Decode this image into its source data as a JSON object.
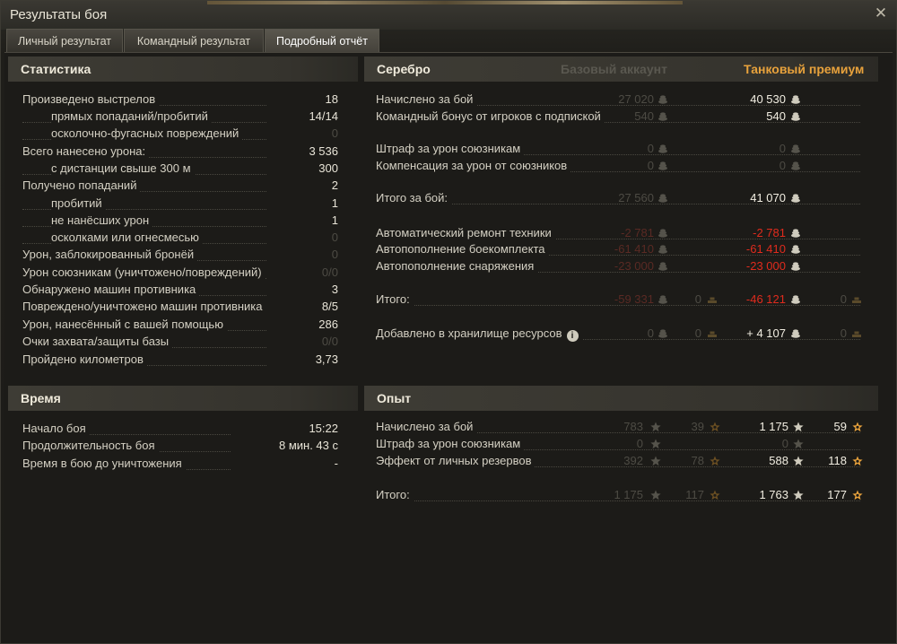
{
  "window": {
    "title": "Результаты боя",
    "close_symbol": "✕"
  },
  "tabs": [
    {
      "label": "Личный результат",
      "active": false
    },
    {
      "label": "Командный результат",
      "active": false
    },
    {
      "label": "Подробный отчёт",
      "active": true
    }
  ],
  "colors": {
    "gold_premium": "#e8a23c",
    "red": "#e02b1d",
    "dim": "#4d4b44"
  },
  "stats": {
    "header": "Статистика",
    "rows": [
      {
        "label": "Произведено выстрелов",
        "value": "18",
        "indent": false,
        "dim": false
      },
      {
        "label": "прямых попаданий/пробитий",
        "value": "14/14",
        "indent": true,
        "dim": false
      },
      {
        "label": "осколочно-фугасных повреждений",
        "value": "0",
        "indent": true,
        "dim": true
      },
      {
        "label": "Всего нанесено урона:",
        "value": "3 536",
        "indent": false,
        "dim": false
      },
      {
        "label": "с дистанции свыше 300 м",
        "value": "300",
        "indent": true,
        "dim": false
      },
      {
        "label": "Получено попаданий",
        "value": "2",
        "indent": false,
        "dim": false
      },
      {
        "label": "пробитий",
        "value": "1",
        "indent": true,
        "dim": false
      },
      {
        "label": "не нанёсших урон",
        "value": "1",
        "indent": true,
        "dim": false
      },
      {
        "label": "осколками или огнесмесью",
        "value": "0",
        "indent": true,
        "dim": true
      },
      {
        "label": "Урон, заблокированный бронёй",
        "value": "0",
        "indent": false,
        "dim": true
      },
      {
        "label": "Урон союзникам (уничтожено/повреждений)",
        "value": "0/0",
        "indent": false,
        "dim": true
      },
      {
        "label": "Обнаружено машин противника",
        "value": "3",
        "indent": false,
        "dim": false
      },
      {
        "label": "Повреждено/уничтожено машин противника",
        "value": "8/5",
        "indent": false,
        "dim": false
      },
      {
        "label": "Урон, нанесённый с вашей помощью",
        "value": "286",
        "indent": false,
        "dim": false
      },
      {
        "label": "Очки захвата/защиты базы",
        "value": "0/0",
        "indent": false,
        "dim": true
      },
      {
        "label": "Пройдено километров",
        "value": "3,73",
        "indent": false,
        "dim": false
      }
    ]
  },
  "time": {
    "header": "Время",
    "rows": [
      {
        "label": "Начало боя",
        "value": "15:22"
      },
      {
        "label": "Продолжительность боя",
        "value": "8 мин. 43 с"
      },
      {
        "label": "Время в бою до уничтожения",
        "value": "-"
      }
    ]
  },
  "silver": {
    "header": "Серебро",
    "col_basic": "Базовый аккаунт",
    "col_premium": "Танковый премиум",
    "rows": [
      {
        "label": "Начислено за бой",
        "basic": "27  020",
        "premium": "40  530",
        "style": "normal",
        "gold": false
      },
      {
        "label": "Командный бонус от игроков с подпиской",
        "basic": "540",
        "premium": "540",
        "style": "normal",
        "gold": false
      },
      {
        "label": "Штраф за урон союзникам",
        "basic": "0",
        "premium": "0",
        "style": "zero",
        "gold": false
      },
      {
        "label": "Компенсация за урон от союзников",
        "basic": "0",
        "premium": "0",
        "style": "zero",
        "gold": false
      },
      {
        "label": "Итого за бой:",
        "basic": "27  560",
        "premium": "41  070",
        "style": "normal",
        "gold": false
      },
      {
        "label": "Автоматический ремонт техники",
        "basic": "-2  781",
        "premium": "-2  781",
        "style": "red",
        "gold": false
      },
      {
        "label": "Автопополнение боекомплекта",
        "basic": "-61  410",
        "premium": "-61  410",
        "style": "red",
        "gold": false
      },
      {
        "label": "Автопополнение снаряжения",
        "basic": "-23  000",
        "premium": "-23  000",
        "style": "red",
        "gold": false
      },
      {
        "label": "Итого:",
        "basic": "-59  331",
        "premium": "-46  121",
        "style": "red",
        "gold": true,
        "basic_gold": "0",
        "premium_gold": "0"
      },
      {
        "label": "Добавлено в хранилище ресурсов",
        "basic": "0",
        "premium": "+ 4  107",
        "style": "storage",
        "gold": true,
        "basic_gold": "0",
        "premium_gold": "0",
        "info": true
      }
    ]
  },
  "experience": {
    "header": "Опыт",
    "rows": [
      {
        "label": "Начислено за бой",
        "basic": "783",
        "basic_free": "39",
        "premium": "1  175",
        "premium_free": "59",
        "has_free": true
      },
      {
        "label": "Штраф за урон союзникам",
        "basic": "0",
        "premium": "0",
        "has_free": false
      },
      {
        "label": "Эффект от личных резервов",
        "basic": "392",
        "basic_free": "78",
        "premium": "588",
        "premium_free": "118",
        "has_free": true
      },
      {
        "label": "Итого:",
        "basic": "1  175",
        "basic_free": "117",
        "premium": "1  763",
        "premium_free": "177",
        "has_free": true
      }
    ]
  },
  "icons": {
    "credits": "credits-icon",
    "gold": "gold-icon",
    "xp": "xp-star-icon",
    "free_xp": "free-xp-star-icon",
    "info": "info-icon"
  }
}
